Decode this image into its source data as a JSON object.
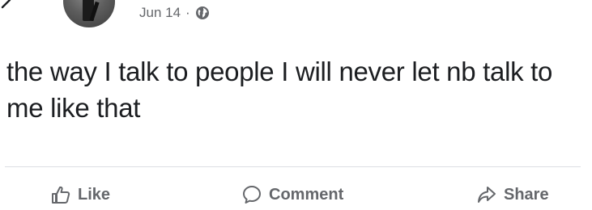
{
  "post": {
    "date": "Jun 14",
    "separator": "·",
    "privacy_icon": "globe-icon",
    "text": "the way I talk to people I will never let nb talk to me like that"
  },
  "actions": {
    "like": {
      "label": "Like",
      "icon": "thumbs-up-icon"
    },
    "comment": {
      "label": "Comment",
      "icon": "comment-icon"
    },
    "share": {
      "label": "Share",
      "icon": "share-icon"
    }
  },
  "colors": {
    "text": "#1c1e21",
    "secondary": "#65676b",
    "divider": "#dcdee3"
  }
}
